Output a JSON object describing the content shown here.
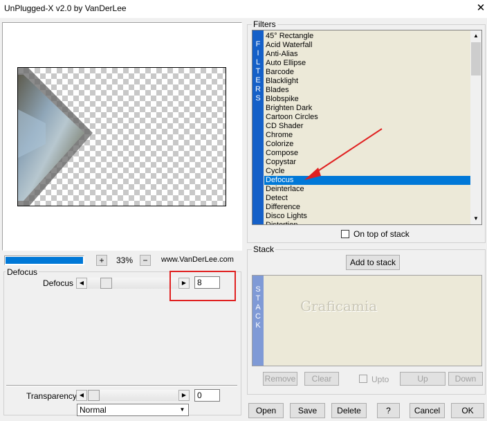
{
  "window": {
    "title": "UnPlugged-X v2.0 by VanDerLee",
    "close_glyph": "✕"
  },
  "preview": {
    "zoom_in": "+",
    "zoom_label": "33%",
    "zoom_out": "−",
    "website": "www.VanDerLee.com",
    "progress": 1.0
  },
  "params": {
    "group_title": "Defocus",
    "defocus": {
      "label": "Defocus",
      "value": "8",
      "slider_level": 0.1
    },
    "transparency": {
      "label": "Transparency",
      "value": "0",
      "slider_level": 0.0
    },
    "blend_mode": "Normal"
  },
  "filters": {
    "group_title": "Filters",
    "side_label": [
      "F",
      "I",
      "L",
      "T",
      "E",
      "R",
      "S"
    ],
    "items": [
      "45° Rectangle",
      "Acid Waterfall",
      "Anti-Alias",
      "Auto Ellipse",
      "Barcode",
      "Blacklight",
      "Blades",
      "Blobspike",
      "Brighten Dark",
      "Cartoon Circles",
      "CD Shader",
      "Chrome",
      "Colorize",
      "Compose",
      "Copystar",
      "Cycle",
      "Defocus",
      "Deinterlace",
      "Detect",
      "Difference",
      "Disco Lights",
      "Distortion"
    ],
    "selected_index": 16,
    "on_top_label": "On top of stack",
    "on_top_checked": false
  },
  "stack": {
    "group_title": "Stack",
    "add_label": "Add to stack",
    "side_label": [
      "S",
      "T",
      "A",
      "C",
      "K"
    ],
    "watermark": "Graficamia",
    "remove_label": "Remove",
    "clear_label": "Clear",
    "upto_label": "Upto",
    "up_label": "Up",
    "down_label": "Down"
  },
  "footer": {
    "open": "Open",
    "save": "Save",
    "delete": "Delete",
    "help": "?",
    "cancel": "Cancel",
    "ok": "OK"
  },
  "colors": {
    "accent": "#0078d7",
    "filters_sidebar": "#1560c8",
    "stack_sidebar": "#7f9ad6",
    "highlight_red": "#e02020"
  }
}
